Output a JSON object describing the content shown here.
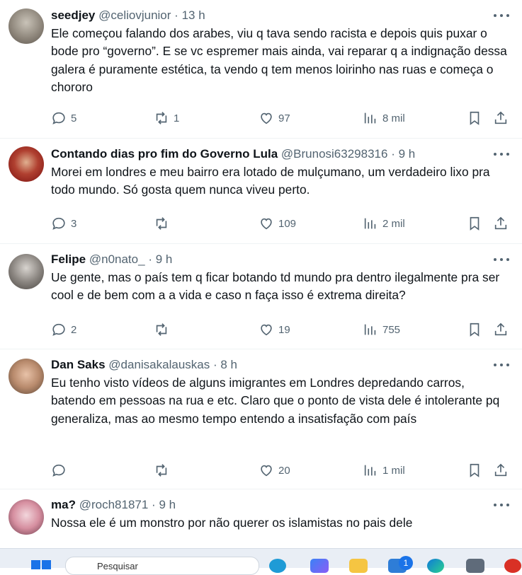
{
  "tweets": [
    {
      "name": "seedjey",
      "handle": "@celiovjunior",
      "time": "13 h",
      "text": "Ele começou falando dos arabes, viu q tava sendo racista e depois quis puxar o bode pro “governo”. E se vc espremer mais ainda, vai reparar q a indignação dessa galera é puramente estética, ta vendo q tem menos loirinho nas ruas e começa o chororo",
      "replies": "5",
      "reposts": "1",
      "likes": "97",
      "views": "8 mil"
    },
    {
      "name": "Contando dias pro fim do Governo Lula",
      "handle": "@Brunosi63298316",
      "time": "9 h",
      "text": "Morei em londres e meu bairro era lotado de mulçumano, um verdadeiro lixo pra todo mundo. Só gosta quem nunca viveu perto.",
      "replies": "3",
      "reposts": "",
      "likes": "109",
      "views": "2 mil"
    },
    {
      "name": "Felipe",
      "handle": "@n0nato_",
      "time": "9 h",
      "text": "Ue gente, mas o país tem q ficar botando td mundo pra dentro ilegalmente pra ser cool e de bem com a a vida e caso n faça isso é extrema direita?",
      "replies": "2",
      "reposts": "",
      "likes": "19",
      "views": "755"
    },
    {
      "name": "Dan Saks",
      "handle": "@danisakalauskas",
      "time": "8 h",
      "text": "Eu tenho visto vídeos de alguns imigrantes em Londres depredando carros, batendo em pessoas na rua e etc. Claro que o ponto de vista dele é intolerante pq generaliza, mas ao mesmo tempo entendo a insatisfação com país",
      "replies": "",
      "reposts": "",
      "likes": "20",
      "views": "1 mil"
    },
    {
      "name": "ma?",
      "handle": "@roch81871",
      "time": "9 h",
      "text": "Nossa ele é um monstro por não querer os islamistas no pais dele"
    }
  ],
  "taskbar": {
    "search_text": "Pesquisar",
    "notification_count": "1"
  },
  "colors": {
    "text": "#0f1419",
    "secondary": "#536471",
    "divider": "#eff3f4"
  },
  "icons": [
    "reply-icon",
    "repost-icon",
    "like-icon",
    "views-icon",
    "bookmark-icon",
    "share-icon",
    "more-icon"
  ]
}
